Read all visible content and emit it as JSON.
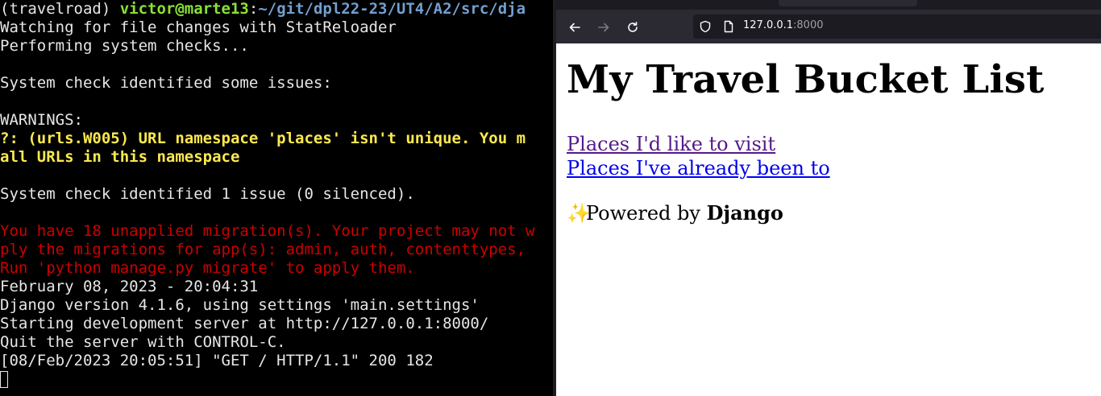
{
  "terminal": {
    "prompt": {
      "env": "(travelroad) ",
      "user": "victor@marte13",
      "sep": ":",
      "path": "~/git/dpl22-23/UT4/A2/src/dja"
    },
    "lines": {
      "watching": "Watching for file changes with StatReloader",
      "performing": "Performing system checks...",
      "blank1": "",
      "issues": "System check identified some issues:",
      "blank2": "",
      "warnings": "WARNINGS:",
      "warn1": "?: (urls.W005) URL namespace 'places' isn't unique. You m",
      "warn2": "all URLs in this namespace",
      "blank3": "",
      "one_issue": "System check identified 1 issue (0 silenced).",
      "blank4": "",
      "err1": "You have 18 unapplied migration(s). Your project may not w",
      "err2": "ply the migrations for app(s): admin, auth, contenttypes,",
      "err3": "Run 'python manage.py migrate' to apply them.",
      "date": "February 08, 2023 - 20:04:31",
      "django_version": "Django version 4.1.6, using settings 'main.settings'",
      "starting": "Starting development server at http://127.0.0.1:8000/",
      "quit": "Quit the server with CONTROL-C.",
      "request": "[08/Feb/2023 20:05:51] \"GET / HTTP/1.1\" 200 182"
    }
  },
  "browser": {
    "url_host": "127.0.0.1",
    "url_port": ":8000",
    "icons": {
      "back": "back-arrow-icon",
      "forward": "forward-arrow-icon",
      "reload": "reload-icon",
      "shield": "shield-icon",
      "page": "page-icon"
    },
    "page": {
      "heading": "My Travel Bucket List",
      "link_to_visit": "Places I'd like to visit",
      "link_visited": "Places I've already been to",
      "powered_prefix": "Powered by ",
      "powered_brand": "Django",
      "sparkle": "✨"
    }
  },
  "colors": {
    "prompt_user": "#8ae234",
    "prompt_path": "#729fcf",
    "warning": "#fce94f",
    "error": "#cc0000",
    "link_visited": "#551a8b",
    "link": "#0000ee"
  }
}
